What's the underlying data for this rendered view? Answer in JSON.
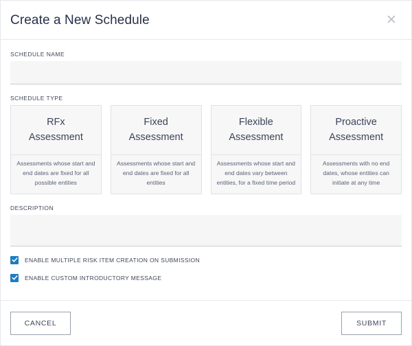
{
  "header": {
    "title": "Create a New Schedule",
    "close_icon": "close-icon",
    "close_glyph": "✕"
  },
  "form": {
    "schedule_name": {
      "label": "SCHEDULE NAME",
      "value": "",
      "placeholder": ""
    },
    "schedule_type": {
      "label": "SCHEDULE TYPE",
      "cards": [
        {
          "title": "RFx\nAssessment",
          "title_line1": "RFx",
          "title_line2": "Assessment",
          "description": "Assessments whose start and end dates are fixed for all possible entities",
          "selected": false
        },
        {
          "title": "Fixed\nAssessment",
          "title_line1": "Fixed",
          "title_line2": "Assessment",
          "description": "Assessments whose start and end dates are fixed for all entities",
          "selected": false
        },
        {
          "title": "Flexible\nAssessment",
          "title_line1": "Flexible",
          "title_line2": "Assessment",
          "description": "Assessments whose start and end dates vary between entities, for a fixed time period",
          "selected": false
        },
        {
          "title": "Proactive\nAssessment",
          "title_line1": "Proactive",
          "title_line2": "Assessment",
          "description": "Assessments with no end dates, whose entities can initiate at any time",
          "selected": false
        }
      ]
    },
    "description": {
      "label": "DESCRIPTION",
      "value": "",
      "placeholder": ""
    },
    "checkboxes": [
      {
        "label": "ENABLE MULTIPLE RISK ITEM CREATION ON SUBMISSION",
        "checked": true
      },
      {
        "label": "ENABLE CUSTOM INTRODUCTORY MESSAGE",
        "checked": true
      }
    ]
  },
  "footer": {
    "cancel_label": "CANCEL",
    "submit_label": "SUBMIT"
  },
  "colors": {
    "accent": "#1d7dc2",
    "title_text": "#27304a",
    "body_text": "#3c4257",
    "card_bg": "#f7f7f8",
    "card_border": "#dfe1e5",
    "input_bg": "#f6f6f7",
    "input_underline": "#c9ccd2",
    "button_border": "#9aa0ac",
    "divider": "#e6e8ec",
    "close_icon": "#bfc3c9"
  }
}
